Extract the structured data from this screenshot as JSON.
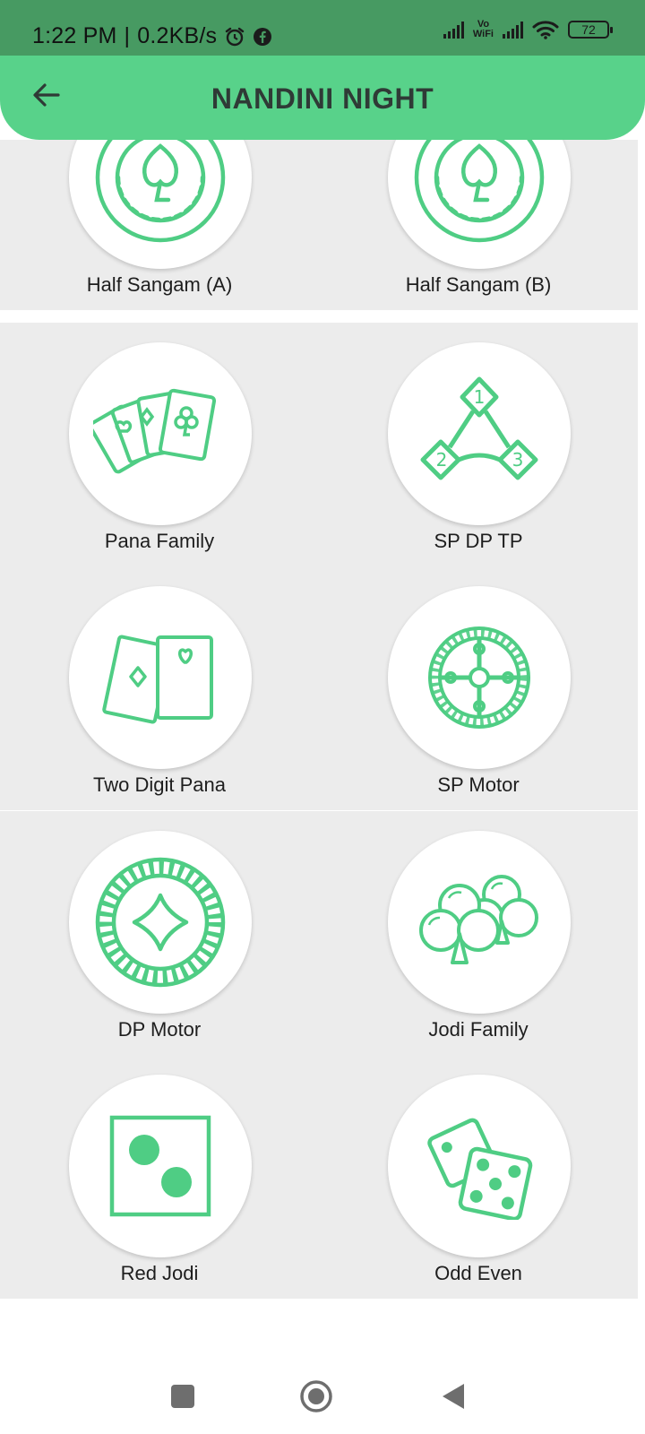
{
  "status_bar": {
    "time": "1:22 PM",
    "separator": "|",
    "net_speed": "0.2KB/s",
    "vowifi": "Vo\nWiFi",
    "battery": "72",
    "icons": [
      "alarm-icon",
      "facebook-icon",
      "signal-icon",
      "vowifi-icon",
      "signal-icon",
      "wifi-icon",
      "battery-icon"
    ]
  },
  "app_bar": {
    "title": "NANDINI NIGHT",
    "back_icon": "arrow-left-icon",
    "color": "#58d28a"
  },
  "accent_color": "#4fcd84",
  "games": [
    {
      "label": "Half Sangam (A)",
      "icon": "chip-spade-icon"
    },
    {
      "label": "Half Sangam (B)",
      "icon": "chip-spade-icon"
    },
    {
      "label": "Pana Family",
      "icon": "playing-cards-icon"
    },
    {
      "label": "SP DP TP",
      "icon": "triangle-diamonds-icon"
    },
    {
      "label": "Two Digit Pana",
      "icon": "two-cards-icon"
    },
    {
      "label": "SP Motor",
      "icon": "roulette-icon"
    },
    {
      "label": "DP Motor",
      "icon": "chip-diamond-icon"
    },
    {
      "label": "Jodi Family",
      "icon": "clubs-icon"
    },
    {
      "label": "Red Jodi",
      "icon": "dice-two-icon"
    },
    {
      "label": "Odd Even",
      "icon": "dice-pair-icon"
    }
  ],
  "nav_bar": {
    "buttons": [
      "recents-button",
      "home-button",
      "back-button"
    ]
  }
}
